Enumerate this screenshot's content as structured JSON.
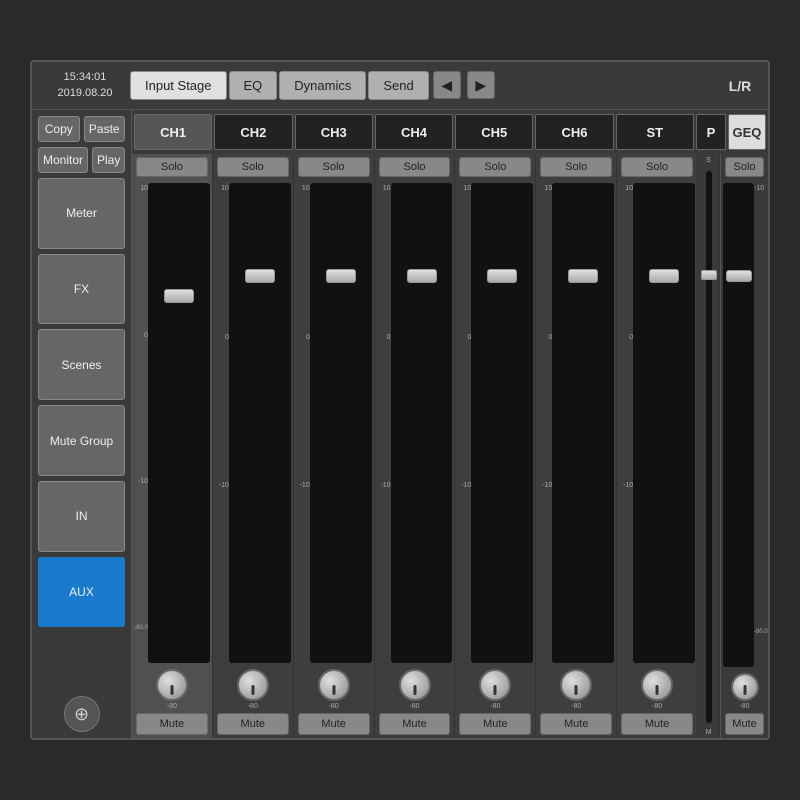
{
  "time": {
    "clock": "15:34:01",
    "date": "2019.08.20"
  },
  "tabs": {
    "input_stage": "Input Stage",
    "eq": "EQ",
    "dynamics": "Dynamics",
    "send": "Send"
  },
  "lr_label": "L/R",
  "geq_label": "GEQ",
  "sidebar": {
    "copy": "Copy",
    "paste": "Paste",
    "monitor": "Monitor",
    "play": "Play",
    "meter": "Meter",
    "fx": "FX",
    "scenes": "Scenes",
    "mute_group": "Mute Group",
    "in": "IN",
    "aux": "AUX"
  },
  "channels": [
    {
      "name": "CH1",
      "dark": false
    },
    {
      "name": "CH2",
      "dark": true
    },
    {
      "name": "CH3",
      "dark": true
    },
    {
      "name": "CH4",
      "dark": true
    },
    {
      "name": "CH5",
      "dark": true
    },
    {
      "name": "CH6",
      "dark": true
    },
    {
      "name": "ST",
      "dark": true
    },
    {
      "name": "P",
      "dark": true
    }
  ],
  "scale": {
    "labels": [
      "10",
      "0",
      "-10",
      "-80.0"
    ]
  },
  "solo_label": "Solo",
  "mute_label": "Mute",
  "db_labels": [
    "10",
    "0",
    "-10",
    "-80"
  ]
}
